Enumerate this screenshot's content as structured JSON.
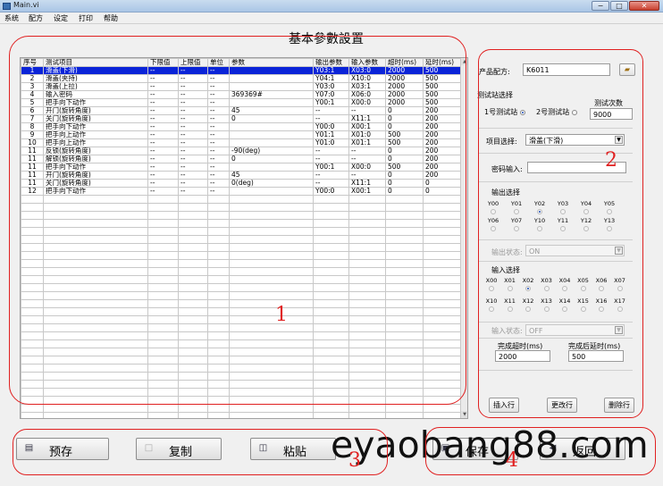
{
  "window": {
    "title": "Main.vi",
    "minimize": "−",
    "maximize": "□",
    "close": "✕"
  },
  "menu": [
    "系统",
    "配方",
    "设定",
    "打印",
    "帮助"
  ],
  "page_title": "基本參數設置",
  "table": {
    "headers": [
      "序号",
      "测试项目",
      "下限值",
      "上限值",
      "单位",
      "参数",
      "输出参数",
      "输入参数",
      "超时(ms)",
      "延时(ms)"
    ],
    "rows": [
      [
        "1",
        "滑盖(下滑)",
        "--",
        "--",
        "--",
        "",
        "Y03:1",
        "X03:0",
        "2000",
        "500"
      ],
      [
        "2",
        "滑盖(夹持)",
        "--",
        "--",
        "--",
        "",
        "Y04:1",
        "X10:0",
        "2000",
        "500"
      ],
      [
        "3",
        "滑盖(上拉)",
        "--",
        "--",
        "--",
        "",
        "Y03:0",
        "X03:1",
        "2000",
        "500"
      ],
      [
        "4",
        "输入密码",
        "--",
        "--",
        "--",
        "369369#",
        "Y07:0",
        "X06:0",
        "2000",
        "500"
      ],
      [
        "5",
        "把手向下动作",
        "--",
        "--",
        "--",
        "",
        "Y00:1",
        "X00:0",
        "2000",
        "500"
      ],
      [
        "6",
        "开门(旋转角度)",
        "--",
        "--",
        "--",
        "45",
        "--",
        "--",
        "0",
        "200"
      ],
      [
        "7",
        "关门(旋转角度)",
        "--",
        "--",
        "--",
        "0",
        "--",
        "X11:1",
        "0",
        "200"
      ],
      [
        "8",
        "把手向下动作",
        "--",
        "--",
        "--",
        "",
        "Y00:0",
        "X00:1",
        "0",
        "200"
      ],
      [
        "9",
        "把手向上动作",
        "--",
        "--",
        "--",
        "",
        "Y01:1",
        "X01:0",
        "500",
        "200"
      ],
      [
        "10",
        "把手向上动作",
        "--",
        "--",
        "--",
        "",
        "Y01:0",
        "X01:1",
        "500",
        "200"
      ],
      [
        "11",
        "反锁(旋转角度)",
        "--",
        "--",
        "--",
        "-90(deg)",
        "--",
        "--",
        "0",
        "200"
      ],
      [
        "11",
        "解锁(旋转角度)",
        "--",
        "--",
        "--",
        "0",
        "--",
        "--",
        "0",
        "200"
      ],
      [
        "11",
        "把手向下动作",
        "--",
        "--",
        "--",
        "",
        "Y00:1",
        "X00:0",
        "500",
        "200"
      ],
      [
        "11",
        "开门(旋转角度)",
        "--",
        "--",
        "--",
        "45",
        "--",
        "--",
        "0",
        "200"
      ],
      [
        "11",
        "关门(旋转角度)",
        "--",
        "--",
        "--",
        "0(deg)",
        "--",
        "X11:1",
        "0",
        "0"
      ],
      [
        "12",
        "把手向下动作",
        "--",
        "--",
        "--",
        "",
        "Y00:0",
        "X00:1",
        "0",
        "0"
      ]
    ],
    "empty_rows": 28
  },
  "panel": {
    "recipe_label": "产品配方:",
    "recipe_value": "K6011",
    "station_label": "测试站选择",
    "station1": "1号测试站",
    "station2": "2号测试站",
    "count_label": "测试次数",
    "count_value": "9000",
    "item_label": "项目选择:",
    "item_value": "滑盖(下滑)",
    "password_label": "密码输入:",
    "password_value": "",
    "output_label": "输出选择",
    "outputs_row1": [
      "Y00",
      "Y01",
      "Y02",
      "Y03",
      "Y04",
      "Y05"
    ],
    "outputs_row2": [
      "Y06",
      "Y07",
      "Y10",
      "Y11",
      "Y12",
      "Y13"
    ],
    "output_selected": "Y02",
    "output_state_label": "输出状态:",
    "output_state_value": "ON",
    "input_label": "输入选择",
    "inputs_row1": [
      "X00",
      "X01",
      "X02",
      "X03",
      "X04",
      "X05",
      "X06",
      "X07"
    ],
    "inputs_row2": [
      "X10",
      "X11",
      "X12",
      "X13",
      "X14",
      "X15",
      "X16",
      "X17"
    ],
    "input_selected": "X02",
    "input_state_label": "输入状态:",
    "input_state_value": "OFF",
    "timeout_label": "完成超时(ms)",
    "timeout_value": "2000",
    "delay_label": "完成后延时(ms)",
    "delay_value": "500",
    "insert_btn": "插入行",
    "modify_btn": "更改行",
    "delete_btn": "删除行"
  },
  "bottom": {
    "prestore": "预存",
    "copy": "复制",
    "paste": "粘贴",
    "save": "保存",
    "back": "返回"
  },
  "annotations": {
    "n1": "1",
    "n2": "2",
    "n3": "3",
    "n4": "4",
    "color": "#e02020"
  },
  "watermark": "eyaobang88.com",
  "colors": {
    "selected_row": "#0a24d8",
    "annotation": "#e02020"
  }
}
